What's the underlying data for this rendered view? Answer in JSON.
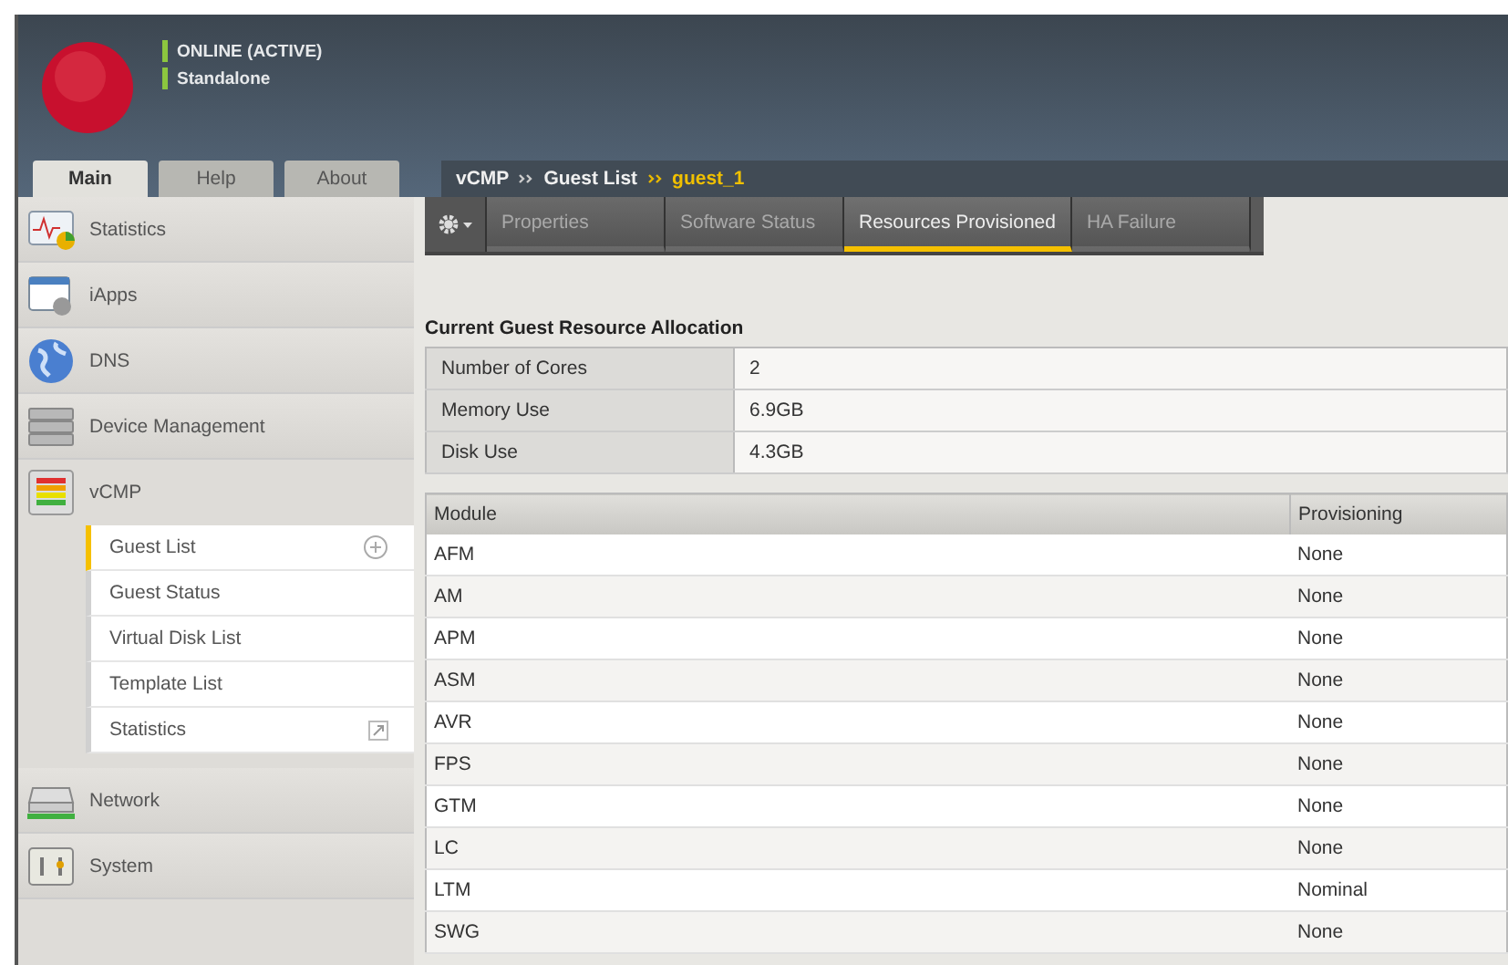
{
  "header": {
    "status": [
      {
        "label": "ONLINE (ACTIVE)",
        "color": "#8cc63f"
      },
      {
        "label": "Standalone",
        "color": "#8cc63f"
      }
    ]
  },
  "main_tabs": [
    {
      "label": "Main",
      "selected": true
    },
    {
      "label": "Help",
      "selected": false
    },
    {
      "label": "About",
      "selected": false
    }
  ],
  "breadcrumb": [
    {
      "label": "vCMP",
      "current": false
    },
    {
      "label": "Guest List",
      "current": false
    },
    {
      "label": "guest_1",
      "current": true
    }
  ],
  "sidebar": {
    "items": [
      {
        "label": "Statistics",
        "expanded": false
      },
      {
        "label": "iApps",
        "expanded": false
      },
      {
        "label": "DNS",
        "expanded": false
      },
      {
        "label": "Device Management",
        "expanded": false
      },
      {
        "label": "vCMP",
        "expanded": true,
        "children": [
          {
            "label": "Guest List",
            "selected": true,
            "kind": "add"
          },
          {
            "label": "Guest Status",
            "selected": false,
            "kind": "plain"
          },
          {
            "label": "Virtual Disk List",
            "selected": false,
            "kind": "plain"
          },
          {
            "label": "Template List",
            "selected": false,
            "kind": "plain"
          },
          {
            "label": "Statistics",
            "selected": false,
            "kind": "external"
          }
        ]
      },
      {
        "label": "Network",
        "expanded": false
      },
      {
        "label": "System",
        "expanded": false
      }
    ]
  },
  "sub_tabs": [
    {
      "label": "Properties",
      "selected": false
    },
    {
      "label": "Software Status",
      "selected": false
    },
    {
      "label": "Resources Provisioned",
      "selected": true
    },
    {
      "label": "HA Failure",
      "selected": false
    }
  ],
  "allocation": {
    "title": "Current Guest Resource Allocation",
    "rows": [
      {
        "label": "Number of Cores",
        "value": "2"
      },
      {
        "label": "Memory Use",
        "value": "6.9GB"
      },
      {
        "label": "Disk Use",
        "value": "4.3GB"
      }
    ]
  },
  "modules": {
    "columns": [
      "Module",
      "Provisioning"
    ],
    "rows": [
      [
        "AFM",
        "None"
      ],
      [
        "AM",
        "None"
      ],
      [
        "APM",
        "None"
      ],
      [
        "ASM",
        "None"
      ],
      [
        "AVR",
        "None"
      ],
      [
        "FPS",
        "None"
      ],
      [
        "GTM",
        "None"
      ],
      [
        "LC",
        "None"
      ],
      [
        "LTM",
        "Nominal"
      ],
      [
        "SWG",
        "None"
      ]
    ]
  }
}
